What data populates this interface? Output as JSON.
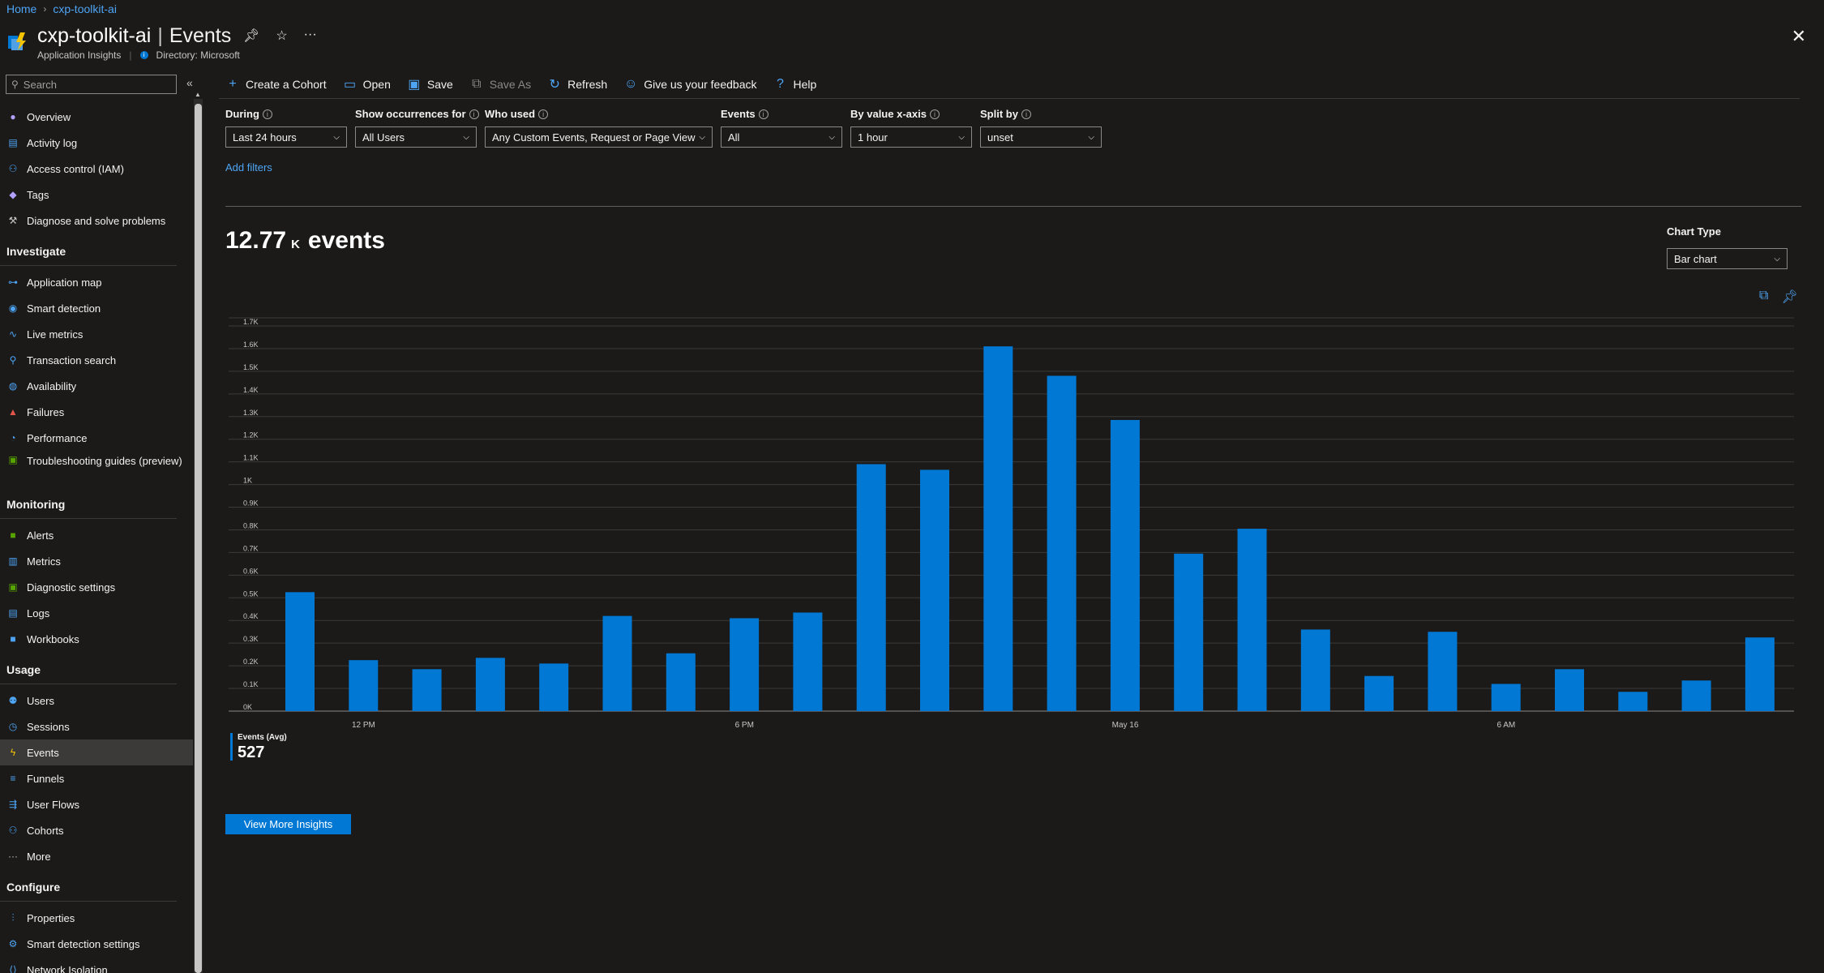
{
  "breadcrumb": {
    "home": "Home",
    "resource": "cxp-toolkit-ai"
  },
  "header": {
    "resource_name": "cxp-toolkit-ai",
    "separator": "|",
    "page": "Events",
    "resource_type": "Application Insights",
    "directory": "Directory: Microsoft"
  },
  "sidebar": {
    "search_placeholder": "Search",
    "top_items": [
      {
        "label": "Overview",
        "icon": "lightbulb-icon",
        "color": "#b4a0ff"
      },
      {
        "label": "Activity log",
        "icon": "activity-log-icon",
        "color": "#4ea5f5"
      },
      {
        "label": "Access control (IAM)",
        "icon": "people-icon",
        "color": "#4ea5f5"
      },
      {
        "label": "Tags",
        "icon": "tag-icon",
        "color": "#b4a0ff"
      },
      {
        "label": "Diagnose and solve problems",
        "icon": "wrench-icon",
        "color": "#c8c6c4"
      }
    ],
    "sections": [
      {
        "title": "Investigate",
        "items": [
          {
            "label": "Application map",
            "icon": "app-map-icon",
            "color": "#4ea5f5"
          },
          {
            "label": "Smart detection",
            "icon": "smart-detection-icon",
            "color": "#4ea5f5"
          },
          {
            "label": "Live metrics",
            "icon": "pulse-icon",
            "color": "#4ea5f5"
          },
          {
            "label": "Transaction search",
            "icon": "search-icon",
            "color": "#4ea5f5"
          },
          {
            "label": "Availability",
            "icon": "globe-icon",
            "color": "#4ea5f5"
          },
          {
            "label": "Failures",
            "icon": "failures-icon",
            "color": "#e3554a"
          },
          {
            "label": "Performance",
            "icon": "performance-icon",
            "color": "#4ea5f5"
          },
          {
            "label": "Troubleshooting guides (preview)",
            "icon": "guide-icon",
            "color": "#57a300"
          }
        ]
      },
      {
        "title": "Monitoring",
        "items": [
          {
            "label": "Alerts",
            "icon": "alert-icon",
            "color": "#57a300"
          },
          {
            "label": "Metrics",
            "icon": "metrics-icon",
            "color": "#4ea5f5"
          },
          {
            "label": "Diagnostic settings",
            "icon": "diagnostic-icon",
            "color": "#57a300"
          },
          {
            "label": "Logs",
            "icon": "logs-icon",
            "color": "#4ea5f5"
          },
          {
            "label": "Workbooks",
            "icon": "workbooks-icon",
            "color": "#4ea5f5"
          }
        ]
      },
      {
        "title": "Usage",
        "items": [
          {
            "label": "Users",
            "icon": "users-icon",
            "color": "#4ea5f5"
          },
          {
            "label": "Sessions",
            "icon": "sessions-icon",
            "color": "#4ea5f5"
          },
          {
            "label": "Events",
            "icon": "events-icon",
            "color": "#f5c400",
            "active": true
          },
          {
            "label": "Funnels",
            "icon": "funnel-icon",
            "color": "#4ea5f5"
          },
          {
            "label": "User Flows",
            "icon": "user-flows-icon",
            "color": "#4ea5f5"
          },
          {
            "label": "Cohorts",
            "icon": "cohorts-icon",
            "color": "#4ea5f5"
          },
          {
            "label": "More",
            "icon": "more-icon",
            "color": "#c8c6c4"
          }
        ]
      },
      {
        "title": "Configure",
        "items": [
          {
            "label": "Properties",
            "icon": "properties-icon",
            "color": "#4ea5f5"
          },
          {
            "label": "Smart detection settings",
            "icon": "settings-icon",
            "color": "#4ea5f5"
          },
          {
            "label": "Network Isolation",
            "icon": "network-icon",
            "color": "#4ea5f5"
          }
        ]
      }
    ]
  },
  "toolbar": [
    {
      "label": "Create a Cohort",
      "icon": "plus-icon",
      "glyph": "+",
      "enabled": true
    },
    {
      "label": "Open",
      "icon": "folder-icon",
      "glyph": "▭",
      "enabled": true
    },
    {
      "label": "Save",
      "icon": "save-icon",
      "glyph": "▣",
      "enabled": true
    },
    {
      "label": "Save As",
      "icon": "save-as-icon",
      "glyph": "⧉",
      "enabled": false
    },
    {
      "label": "Refresh",
      "icon": "refresh-icon",
      "glyph": "↻",
      "enabled": true
    },
    {
      "label": "Give us your feedback",
      "icon": "feedback-icon",
      "glyph": "☺",
      "enabled": true
    },
    {
      "label": "Help",
      "icon": "help-icon",
      "glyph": "?",
      "enabled": true
    }
  ],
  "filters": [
    {
      "label": "During",
      "value": "Last 24 hours"
    },
    {
      "label": "Show occurrences for",
      "value": "All Users"
    },
    {
      "label": "Who used",
      "value": "Any Custom Events, Request or Page View"
    },
    {
      "label": "Events",
      "value": "All"
    },
    {
      "label": "By value x-axis",
      "value": "1 hour"
    },
    {
      "label": "Split by",
      "value": "unset"
    }
  ],
  "add_filters": "Add filters",
  "summary": {
    "count": "12.77",
    "unit": "K",
    "label": "events"
  },
  "chart_type": {
    "label": "Chart Type",
    "value": "Bar chart"
  },
  "legend": {
    "title": "Events (Avg)",
    "value": "527",
    "color": "#0078d4"
  },
  "view_more": "View More Insights",
  "chart_data": {
    "type": "bar",
    "bar_color": "#0078d4",
    "ylim": [
      0,
      1700
    ],
    "y_ticks": [
      {
        "value": 0,
        "label": "0K"
      },
      {
        "value": 100,
        "label": "0.1K"
      },
      {
        "value": 200,
        "label": "0.2K"
      },
      {
        "value": 300,
        "label": "0.3K"
      },
      {
        "value": 400,
        "label": "0.4K"
      },
      {
        "value": 500,
        "label": "0.5K"
      },
      {
        "value": 600,
        "label": "0.6K"
      },
      {
        "value": 700,
        "label": "0.7K"
      },
      {
        "value": 800,
        "label": "0.8K"
      },
      {
        "value": 900,
        "label": "0.9K"
      },
      {
        "value": 1000,
        "label": "1K"
      },
      {
        "value": 1100,
        "label": "1.1K"
      },
      {
        "value": 1200,
        "label": "1.2K"
      },
      {
        "value": 1300,
        "label": "1.3K"
      },
      {
        "value": 1400,
        "label": "1.4K"
      },
      {
        "value": 1500,
        "label": "1.5K"
      },
      {
        "value": 1600,
        "label": "1.6K"
      },
      {
        "value": 1700,
        "label": "1.7K"
      }
    ],
    "x_ticks": [
      {
        "index": 1.5,
        "label": "12 PM"
      },
      {
        "index": 7.5,
        "label": "6 PM"
      },
      {
        "index": 13.5,
        "label": "May 16"
      },
      {
        "index": 19.5,
        "label": "6 AM"
      }
    ],
    "values": [
      525,
      225,
      185,
      235,
      210,
      420,
      255,
      410,
      435,
      1090,
      1065,
      1610,
      1480,
      1285,
      695,
      805,
      360,
      155,
      350,
      120,
      185,
      85,
      135,
      325
    ]
  }
}
